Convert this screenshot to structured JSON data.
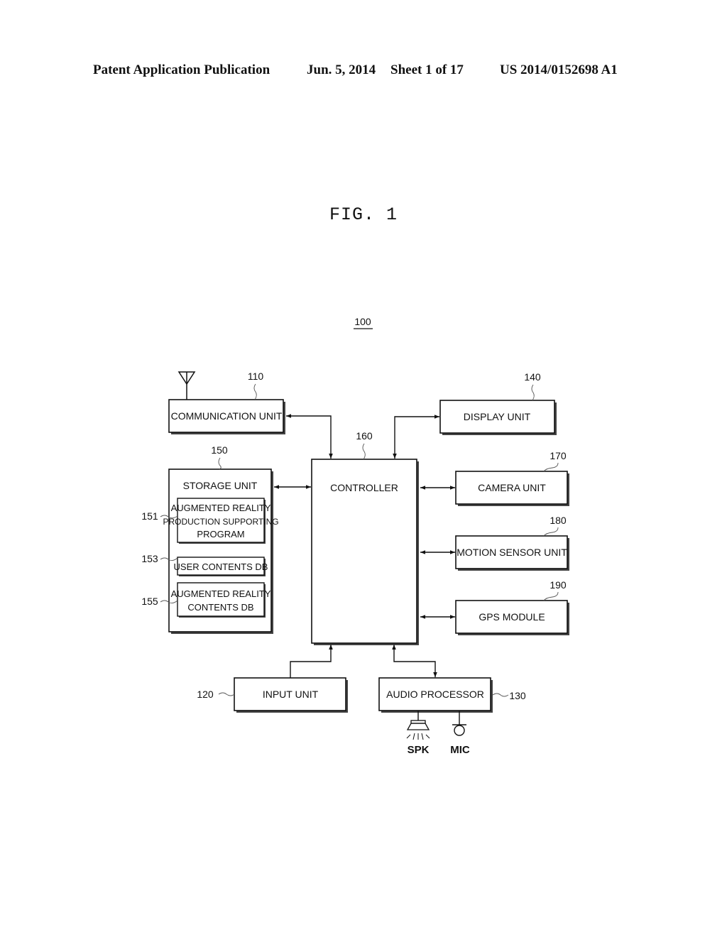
{
  "header": {
    "publication_type": "Patent Application Publication",
    "date": "Jun. 5, 2014",
    "sheet": "Sheet 1 of 17",
    "pub_number": "US 2014/0152698 A1"
  },
  "figure": {
    "title": "FIG. 1",
    "system_ref": "100"
  },
  "blocks": {
    "communication_unit": {
      "label": "COMMUNICATION UNIT",
      "ref": "110"
    },
    "input_unit": {
      "label": "INPUT UNIT",
      "ref": "120"
    },
    "audio_processor": {
      "label": "AUDIO PROCESSOR",
      "ref": "130"
    },
    "display_unit": {
      "label": "DISPLAY UNIT",
      "ref": "140"
    },
    "storage_unit": {
      "label": "STORAGE UNIT",
      "ref": "150"
    },
    "ar_program": {
      "line1": "AUGMENTED REALITY",
      "line2": "PRODUCTION SUPPORTING",
      "line3": "PROGRAM",
      "ref": "151"
    },
    "user_contents_db": {
      "label": "USER CONTENTS DB",
      "ref": "153"
    },
    "ar_contents_db": {
      "line1": "AUGMENTED REALITY",
      "line2": "CONTENTS DB",
      "ref": "155"
    },
    "controller": {
      "label": "CONTROLLER",
      "ref": "160"
    },
    "camera_unit": {
      "label": "CAMERA UNIT",
      "ref": "170"
    },
    "motion_sensor_unit": {
      "label": "MOTION SENSOR UNIT",
      "ref": "180"
    },
    "gps_module": {
      "label": "GPS MODULE",
      "ref": "190"
    }
  },
  "peripherals": {
    "speaker": "SPK",
    "microphone": "MIC"
  }
}
